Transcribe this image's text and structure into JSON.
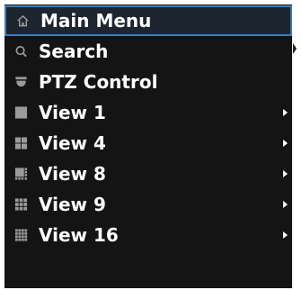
{
  "menu": {
    "items": [
      {
        "label": "Main Menu",
        "icon": "home-icon",
        "selected": true
      },
      {
        "label": "Search",
        "icon": "search-icon"
      },
      {
        "label": "PTZ Control",
        "icon": "ptz-dome-icon"
      },
      {
        "label": "View 1",
        "icon": "view-1-icon",
        "submenu": true
      },
      {
        "label": "View 4",
        "icon": "view-4-icon",
        "submenu": true
      },
      {
        "label": "View 8",
        "icon": "view-8-icon",
        "submenu": true
      },
      {
        "label": "View 9",
        "icon": "view-9-icon",
        "submenu": true
      },
      {
        "label": "View 16",
        "icon": "view-16-icon",
        "submenu": true
      }
    ]
  },
  "colors": {
    "background": "#141414",
    "text": "#ffffff",
    "selected_border": "#3f7fb6",
    "icon": "#9a9a9a"
  }
}
